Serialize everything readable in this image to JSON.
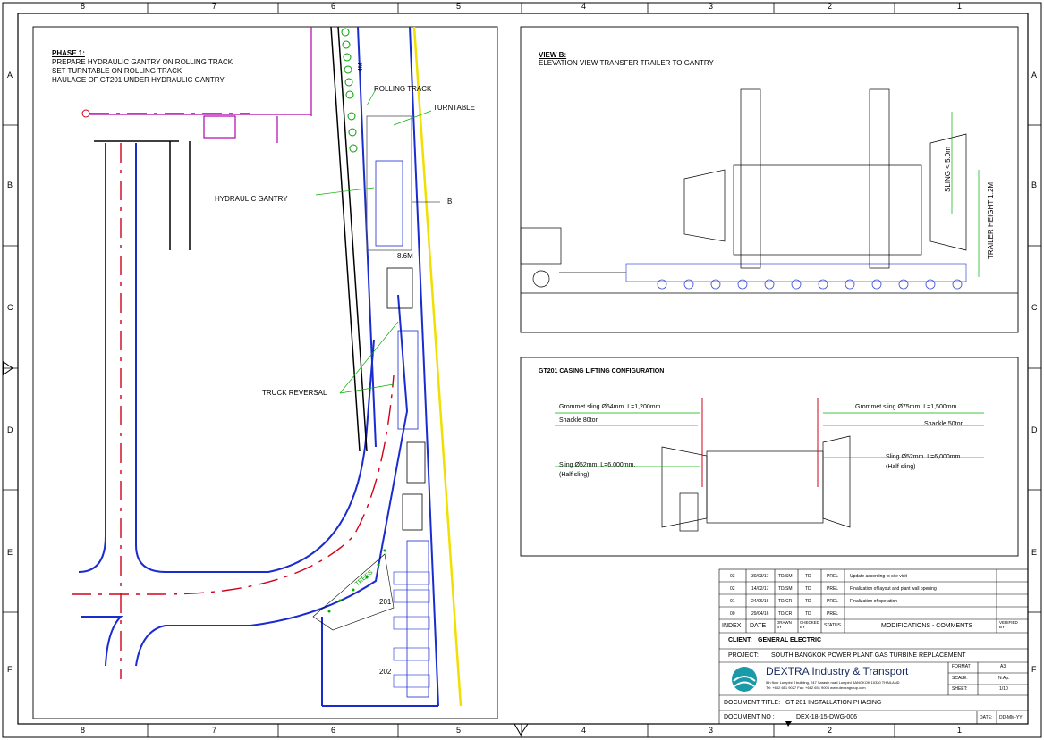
{
  "frame": {
    "columns_top": [
      "8",
      "7",
      "6",
      "5",
      "4",
      "3",
      "2",
      "1"
    ],
    "columns_bottom": [
      "8",
      "7",
      "6",
      "5",
      "4",
      "3",
      "2",
      "1"
    ],
    "rows_left": [
      "A",
      "B",
      "C",
      "D",
      "E",
      "F"
    ],
    "rows_right": [
      "A",
      "B",
      "C",
      "D",
      "E",
      "F"
    ]
  },
  "phase": {
    "title": "PHASE 1:",
    "line1": "PREPARE HYDRAULIC GANTRY ON ROLLING TRACK",
    "line2": "SET TURNTABLE ON ROLLING TRACK",
    "line3": "HAULAGE OF GT201 UNDER HYDRAULIC GANTRY"
  },
  "plan_labels": {
    "rolling_track": "ROLLING TRACK",
    "turntable": "TURNTABLE",
    "hydraulic_gantry": "HYDRAULIC GANTRY",
    "b_marker": "B",
    "dim_86": "8.6M",
    "dim_4m": "4M",
    "truck_reversal": "TRUCK REVERSAL",
    "trees": "TREES",
    "unit_201": "201",
    "unit_202": "202"
  },
  "view_b": {
    "title": "VIEW B:",
    "subtitle": "ELEVATION VIEW TRANSFER TRAILER TO GANTRY",
    "sling": "SLING < 5.0m",
    "trailer_height": "TRAILER HEIGHT 1.2M"
  },
  "lifting": {
    "title": "GT201 CASING LIFTING CONFIGURATION",
    "left_grommet": "Grommet sling Ø64mm. L=1,200mm.",
    "left_shackle": "Shackle 80ton",
    "left_sling": "Sling Ø52mm. L=6,000mm.",
    "left_half": "(Half sling)",
    "right_grommet": "Grommet sling Ø75mm. L=1,500mm.",
    "right_shackle": "Shackle 50ton",
    "right_sling": "Sling Ø52mm. L=6,000mm.",
    "right_half": "(Half sling)"
  },
  "revisions": [
    {
      "index": "03",
      "date": "30/03/17",
      "drawn": "TD/SM",
      "checked": "TD",
      "status": "PREL",
      "comment": "Update according to site visit"
    },
    {
      "index": "02",
      "date": "14/02/17",
      "drawn": "TD/SM",
      "checked": "TD",
      "status": "PREL",
      "comment": "Finalization of layout and plant wall opening"
    },
    {
      "index": "01",
      "date": "24/06/16",
      "drawn": "TD/CR",
      "checked": "TD",
      "status": "PREL",
      "comment": "Finalization of operation"
    },
    {
      "index": "00",
      "date": "29/04/16",
      "drawn": "TD/CR",
      "checked": "TD",
      "status": "PREL",
      "comment": ""
    }
  ],
  "title_block": {
    "h_index": "INDEX",
    "h_date": "DATE",
    "h_drawn": "DRAWN BY",
    "h_checked": "CHECKED BY",
    "h_status": "STATUS",
    "h_modifications": "MODIFICATIONS - COMMENTS",
    "h_verified": "VERIFIED BY",
    "client_label": "CLIENT:",
    "client_value": "GENERAL ELECTRIC",
    "project_label": "PROJECT:",
    "project_value": "SOUTH BANGKOK POWER PLANT GAS TURBINE REPLACEMENT",
    "company_name": "DEXTRA Industry & Transport",
    "company_addr1": "5th floor Lumpini II building, 247 Sarasin road Lumpini BANGKOK 10330 THAILAND",
    "company_addr2": "Tel: +662 651 9027 Fax: +662 651 9005 www.dextragroup.com",
    "format_label": "FORMAT",
    "format_value": "A3",
    "scale_label": "SCALE:",
    "scale_value": "N.Ap.",
    "sheet_label": "SHEET:",
    "sheet_value": "1/10",
    "doc_title_label": "DOCUMENT TITLE:",
    "doc_title_value": "GT 201 INSTALLATION PHASING",
    "doc_no_label": "DOCUMENT NO :",
    "doc_no_value": "DEX-18-15-DWG-006",
    "date_label": "DATE:",
    "date_value": "DD-MM-YY"
  },
  "colors": {
    "road_blue": "#1a2bd0",
    "center_red": "#d0021b",
    "wall_magenta": "#b000b0",
    "green": "#00b000",
    "yellow": "#f0e000",
    "cyan": "#00b8d0",
    "trailer_blue": "#3a4bd8",
    "logo_teal": "#1a9aa8"
  }
}
